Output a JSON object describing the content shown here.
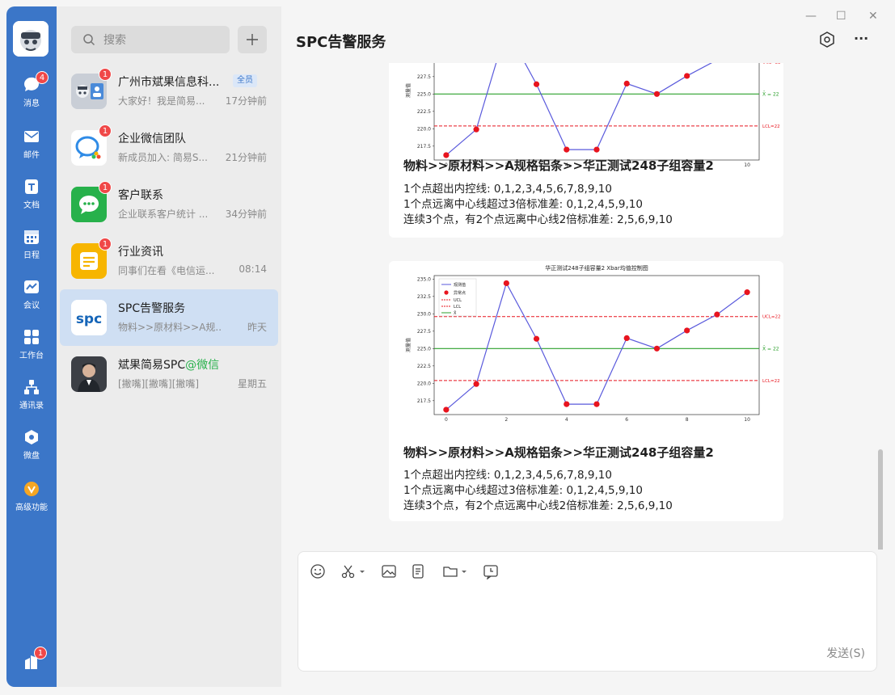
{
  "rail": {
    "items": [
      {
        "label": "消息",
        "badge": "4"
      },
      {
        "label": "邮件"
      },
      {
        "label": "文档"
      },
      {
        "label": "日程"
      },
      {
        "label": "会议"
      },
      {
        "label": "工作台"
      },
      {
        "label": "通讯录"
      },
      {
        "label": "微盘"
      },
      {
        "label": "高级功能"
      }
    ],
    "bottom_badge": "1"
  },
  "search": {
    "placeholder": "搜索"
  },
  "conversations": [
    {
      "title": "广州市斌果信息科...",
      "tag": "全员",
      "preview": "大家好！我是简易...",
      "time": "17分钟前",
      "badge": "1"
    },
    {
      "title": "企业微信团队",
      "preview": "新成员加入: 简易S...",
      "time": "21分钟前",
      "badge": "1"
    },
    {
      "title": "客户联系",
      "preview": "企业联系客户统计 ...",
      "time": "34分钟前",
      "badge": "1"
    },
    {
      "title": "行业资讯",
      "preview": "同事们在看《电信运...",
      "time": "08:14",
      "badge": "1"
    },
    {
      "title": "SPC告警服务",
      "preview": "物料>>原材料>>A规...",
      "time": "昨天",
      "avatar_text": "spc"
    },
    {
      "title": "斌果简易SPC",
      "title_suffix": "@微信",
      "preview": "[撇嘴][撇嘴][撇嘴]",
      "time": "星期五"
    }
  ],
  "chat": {
    "title": "SPC告警服务",
    "window": {
      "minimize": "—",
      "maximize": "☐",
      "close": "✕"
    },
    "more": "···",
    "messages": [
      {
        "heading": "物料>>原材料>>A规格铝条>>华正测试248子组容量2",
        "lines": [
          "1个点超出内控线: 0,1,2,3,4,5,6,7,8,9,10",
          "1个点远离中心线超过3倍标准差: 0,1,2,4,5,9,10",
          "连续3个点，有2个点远离中心线2倍标准差: 2,5,6,9,10"
        ]
      },
      {
        "heading": "物料>>原材料>>A规格铝条>>华正测试248子组容量2",
        "lines": [
          "1个点超出内控线: 0,1,2,3,4,5,6,7,8,9,10",
          "1个点远离中心线超过3倍标准差: 0,1,2,4,5,9,10",
          "连续3个点，有2个点远离中心线2倍标准差: 2,5,6,9,10"
        ]
      }
    ]
  },
  "composer": {
    "send_label": "发送(S)"
  },
  "chart_data": {
    "type": "line",
    "title": "华正测试248子组容量2 Xbar均值控制图",
    "ylabel": "测量值",
    "x": [
      0,
      1,
      2,
      3,
      4,
      5,
      6,
      7,
      8,
      9,
      10
    ],
    "series": [
      {
        "name": "观测值",
        "values": [
          216.2,
          219.9,
          234.4,
          226.4,
          217.0,
          217.0,
          226.5,
          225.0,
          227.6,
          229.9,
          233.1
        ]
      }
    ],
    "abnormal_name": "异常点",
    "ucl": {
      "name": "UCL",
      "value": 229.6,
      "label": "UCL=22"
    },
    "lcl": {
      "name": "LCL",
      "value": 220.4,
      "label": "LCL=22"
    },
    "center": {
      "name": "X̄",
      "value": 225.0,
      "label": "X̄ = 22"
    },
    "yticks": [
      217.5,
      220.0,
      222.5,
      225.0,
      227.5,
      230.0,
      232.5,
      235.0
    ],
    "xticks": [
      0,
      2,
      4,
      6,
      8,
      10
    ],
    "ylim": [
      215.5,
      235.5
    ],
    "xlim": [
      -0.4,
      10.4
    ],
    "colors": {
      "line": "#5a5adc",
      "abnormal": "#e8141e",
      "limit": "#e8141e",
      "center": "#2ca02c"
    }
  }
}
